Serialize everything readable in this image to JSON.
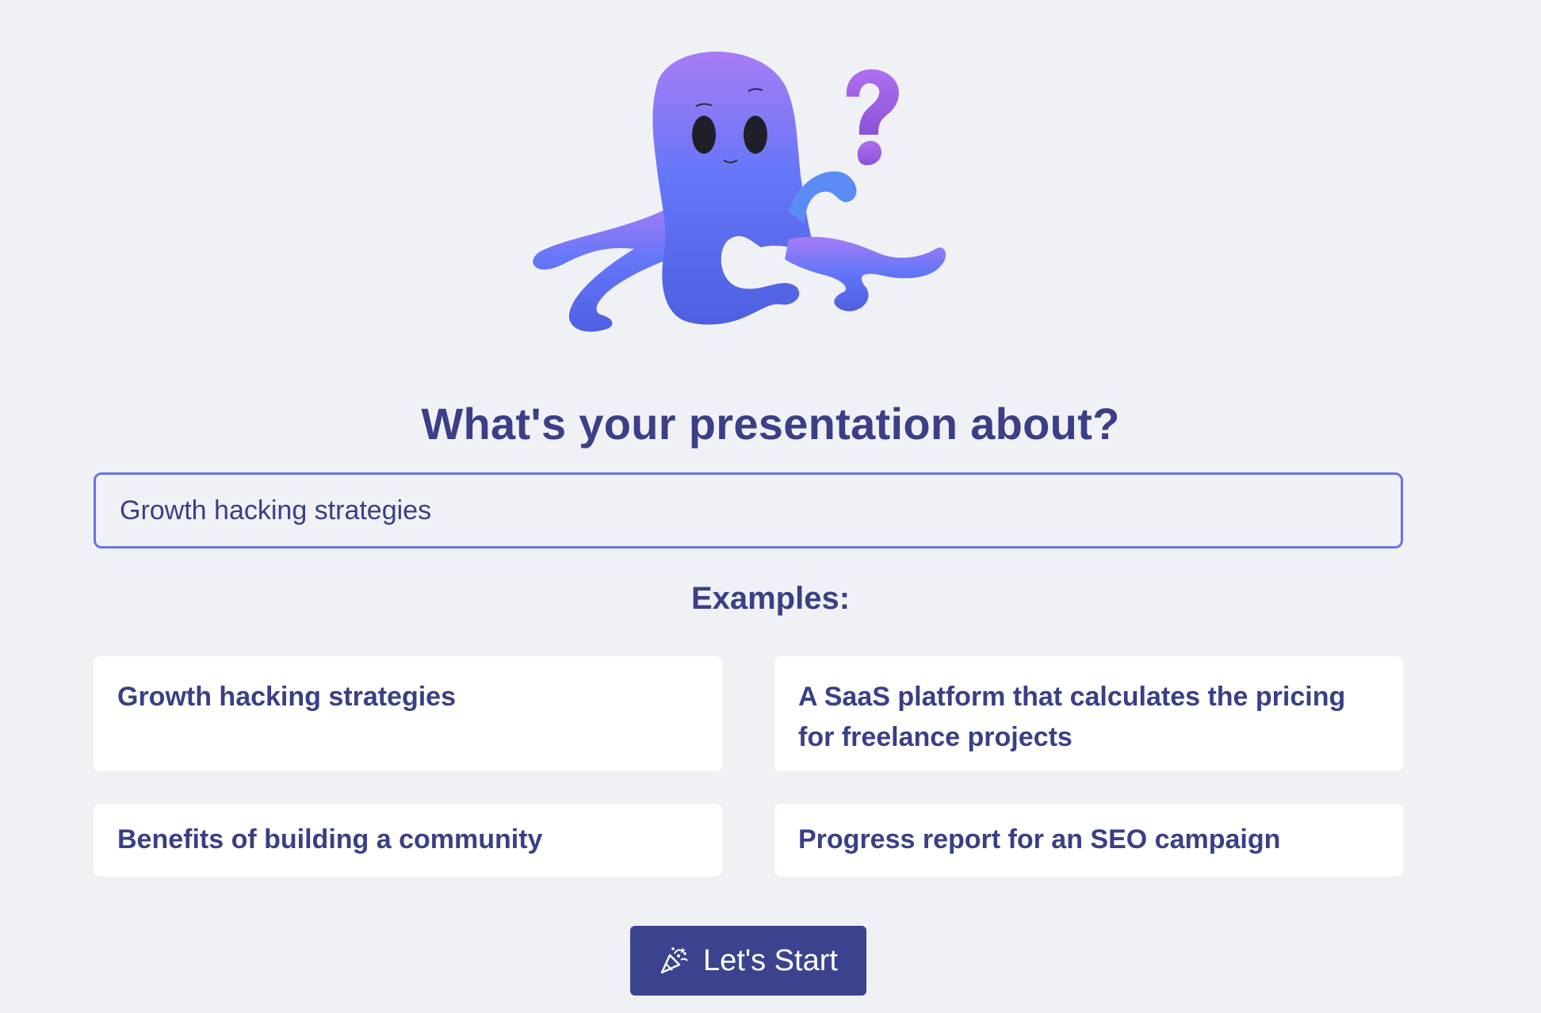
{
  "headline": "What's your presentation about?",
  "topic_input": {
    "value": "Growth hacking strategies"
  },
  "examples": {
    "label": "Examples:",
    "items": [
      "Growth hacking strategies",
      "A SaaS platform that calculates the pricing for freelance projects",
      "Benefits of building a community",
      "Progress report for an SEO campaign"
    ]
  },
  "start_button": {
    "label": "Let's Start",
    "icon": "party-popper-icon"
  },
  "mascot": {
    "icon": "octopus-question-mascot"
  },
  "colors": {
    "background": "#f0f1f5",
    "text": "#3a3f86",
    "input_border": "#6a74e4",
    "button": "#3c438e",
    "card": "#ffffff",
    "mascot_top": "#a87cf5",
    "mascot_body": "#5f6cf6",
    "question_mark": "#a05fe6"
  }
}
